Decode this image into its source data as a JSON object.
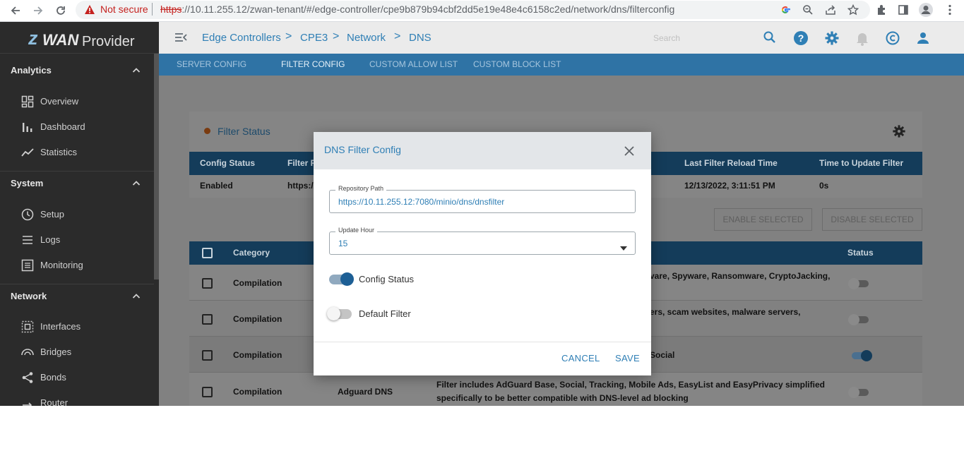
{
  "browser": {
    "not_secure": "Not secure",
    "url_scheme": "https",
    "url_rest": "://10.11.255.12/zwan-tenant/#/edge-controller/cpe9b879b94cbf2dd5e19e48e4c6158c2ed/network/dns/filterconfig"
  },
  "sidebar": {
    "logo_z": "z",
    "logo_wan": "WAN",
    "logo_provider": "Provider",
    "sections": [
      {
        "title": "Analytics",
        "items": [
          "Overview",
          "Dashboard",
          "Statistics"
        ]
      },
      {
        "title": "System",
        "items": [
          "Setup",
          "Logs",
          "Monitoring"
        ]
      },
      {
        "title": "Network",
        "items": [
          "Interfaces",
          "Bridges",
          "Bonds",
          "Router"
        ]
      }
    ]
  },
  "header": {
    "breadcrumb": [
      "Edge Controllers",
      "CPE3",
      "Network",
      "DNS"
    ],
    "breadcrumb_sep": ">",
    "search_placeholder": "Search"
  },
  "tabs": [
    "SERVER CONFIG",
    "FILTER CONFIG",
    "CUSTOM ALLOW LIST",
    "CUSTOM BLOCK LIST"
  ],
  "filter_status": {
    "title": "Filter Status",
    "columns": [
      "Config Status",
      "Filter R",
      "Last Filter Reload Time",
      "Time to Update Filter"
    ],
    "row": [
      "Enabled",
      "https://",
      "12/13/2022, 3:11:51 PM",
      "0s"
    ]
  },
  "actions": {
    "enable_selected": "ENABLE SELECTED",
    "disable_selected": "DISABLE SELECTED"
  },
  "filter_list": {
    "columns": [
      "Category",
      "Status"
    ],
    "rows": [
      {
        "category": "Compilation",
        "name": "",
        "desc1": "vare, Spyware, Ransomware, CryptoJacking,",
        "desc2": "",
        "enabled": false
      },
      {
        "category": "Compilation",
        "name": "",
        "desc1": "ers, scam websites, malware servers,",
        "desc2": "",
        "enabled": false
      },
      {
        "category": "Compilation",
        "name": "",
        "desc1": "Social",
        "desc2": "",
        "enabled": true
      },
      {
        "category": "Compilation",
        "name": "Adguard DNS",
        "desc1": "Filter includes AdGuard Base, Social, Tracking, Mobile Ads, EasyList and EasyPrivacy simplified",
        "desc2": "specifically to be better compatible with DNS-level ad blocking",
        "enabled": false
      }
    ]
  },
  "dialog": {
    "title": "DNS Filter Config",
    "repo_label": "Repository Path",
    "repo_value": "https://10.11.255.12:7080/minio/dns/dnsfilter",
    "hour_label": "Update Hour",
    "hour_value": "15",
    "config_status_label": "Config Status",
    "config_status_on": true,
    "default_filter_label": "Default Filter",
    "default_filter_on": false,
    "cancel": "CANCEL",
    "save": "SAVE"
  }
}
